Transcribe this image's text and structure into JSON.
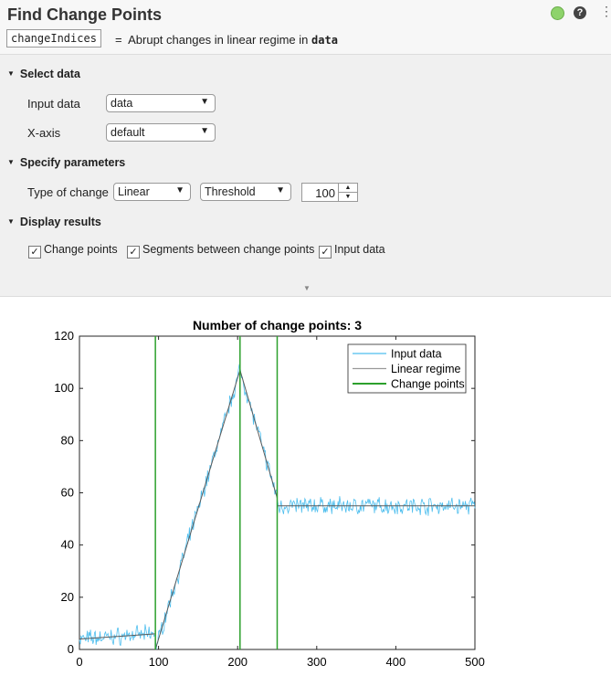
{
  "header": {
    "title": "Find Change Points",
    "output_var": "changeIndices",
    "equals": "=",
    "description": "Abrupt changes in linear regime in",
    "input_var": "data",
    "status_color": "#8ed36b",
    "help_icon": "question-circle-icon",
    "menu_icon": "vertical-ellipsis-icon"
  },
  "select_data": {
    "title": "Select data",
    "input_label": "Input data",
    "input_value": "data",
    "xaxis_label": "X-axis",
    "xaxis_value": "default"
  },
  "parameters": {
    "title": "Specify parameters",
    "type_label": "Type of change",
    "type_value": "Linear",
    "method_value": "Threshold",
    "threshold_value": "100"
  },
  "display": {
    "title": "Display results",
    "checkboxes": [
      {
        "label": "Change points",
        "checked": true
      },
      {
        "label": "Segments between change points",
        "checked": true
      },
      {
        "label": "Input data",
        "checked": true
      }
    ]
  },
  "chart_data": {
    "type": "line",
    "title": "Number of change points: 3",
    "xlim": [
      0,
      500
    ],
    "ylim": [
      0,
      120
    ],
    "xticks": [
      "0",
      "100",
      "200",
      "300",
      "400",
      "500"
    ],
    "yticks": [
      "0",
      "20",
      "40",
      "60",
      "80",
      "100",
      "120"
    ],
    "legend": {
      "placement": "top-right",
      "entries": [
        "Input data",
        "Linear regime",
        "Change points"
      ]
    },
    "colors": {
      "input": "#4dbeee",
      "regime": "#5a5a5a",
      "change": "#2ca02c"
    },
    "change_points": [
      96,
      203,
      250
    ],
    "segments": [
      {
        "x": [
          0,
          96
        ],
        "y": [
          4,
          6
        ]
      },
      {
        "x": [
          96,
          203
        ],
        "y": [
          0,
          107
        ]
      },
      {
        "x": [
          203,
          250
        ],
        "y": [
          107,
          58
        ]
      },
      {
        "x": [
          250,
          500
        ],
        "y": [
          55,
          55
        ]
      }
    ],
    "noise_amplitude": 2.5,
    "n_points": 500
  }
}
